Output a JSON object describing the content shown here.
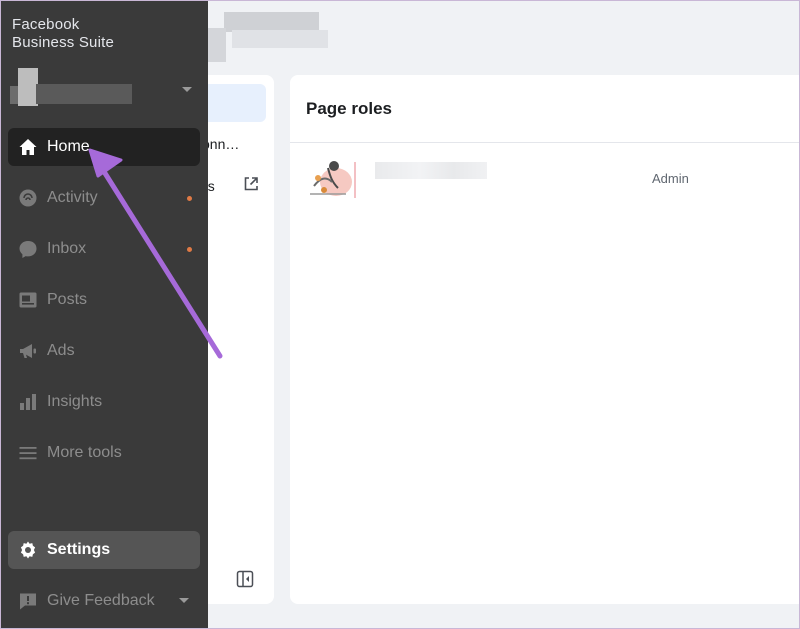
{
  "sidebar": {
    "brand_line1": "Facebook",
    "brand_line2": "Business Suite",
    "items": [
      {
        "label": "Home",
        "icon": "home-icon"
      },
      {
        "label": "Activity",
        "icon": "activity-icon"
      },
      {
        "label": "Inbox",
        "icon": "inbox-icon"
      },
      {
        "label": "Posts",
        "icon": "posts-icon"
      },
      {
        "label": "Ads",
        "icon": "ads-icon"
      },
      {
        "label": "Insights",
        "icon": "insights-icon"
      },
      {
        "label": "More tools",
        "icon": "menu-icon"
      }
    ],
    "settings_label": "Settings",
    "feedback_label": "Give Feedback"
  },
  "middle": {
    "item1": "onn…",
    "item2": "gs"
  },
  "main": {
    "title": "Page roles",
    "roles": [
      {
        "role": "Admin"
      }
    ]
  },
  "colors": {
    "sidebar_bg": "#3a3a3a",
    "active_bg": "#222222",
    "settings_bg": "#555555",
    "notification_dot": "#e07a45",
    "arrow": "#a66ad9"
  }
}
